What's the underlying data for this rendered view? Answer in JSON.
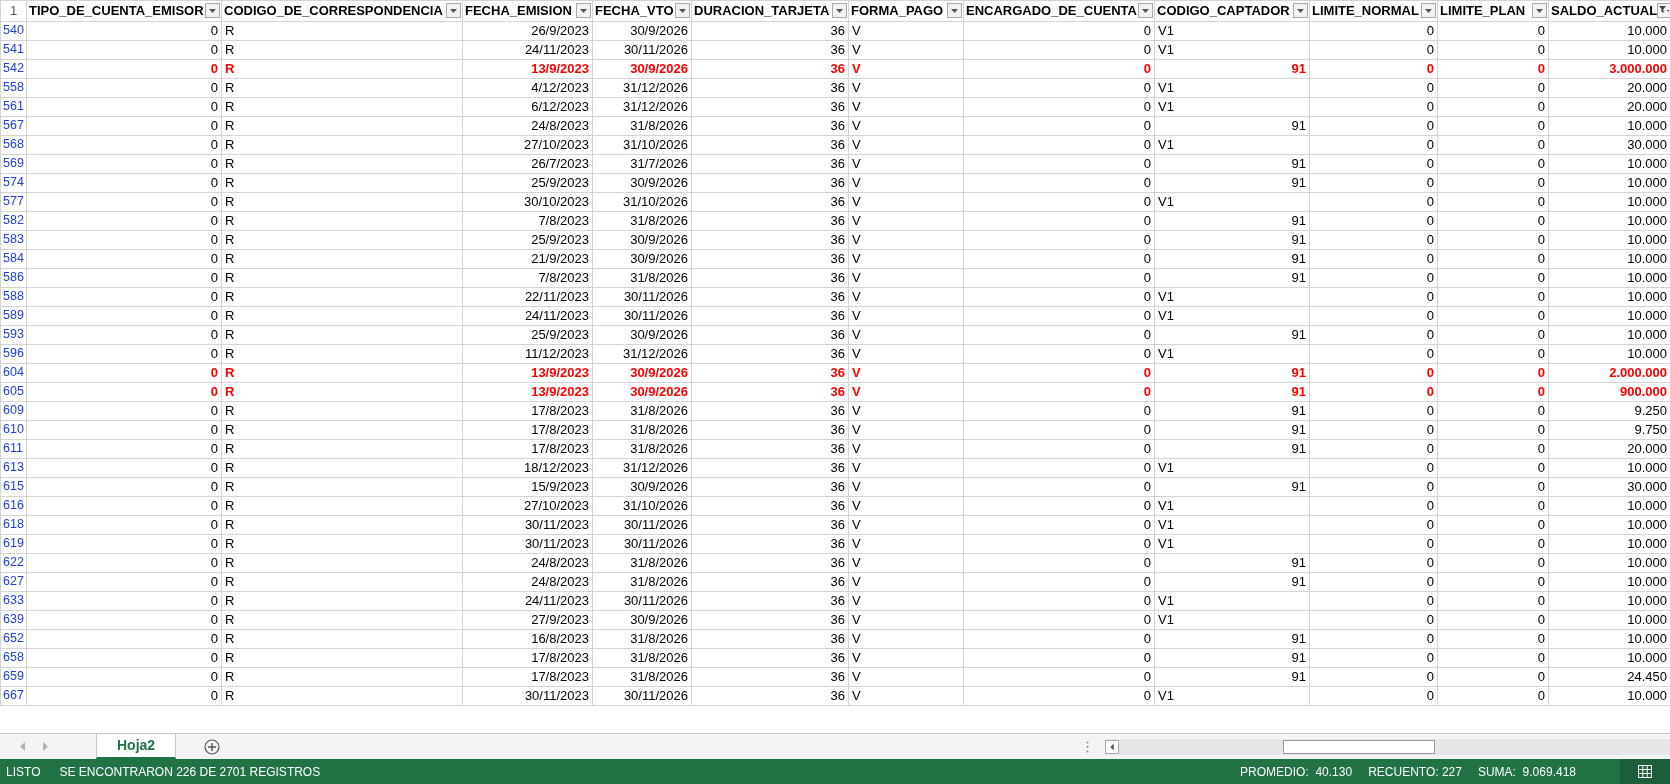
{
  "corner": "1",
  "columns": [
    {
      "label": "TIPO_DE_CUENTA_EMISOR",
      "filtered": false
    },
    {
      "label": "CODIGO_DE_CORRESPONDENCIA",
      "filtered": false
    },
    {
      "label": "FECHA_EMISION",
      "filtered": false
    },
    {
      "label": "FECHA_VTO",
      "filtered": false
    },
    {
      "label": "DURACION_TARJETA",
      "filtered": false
    },
    {
      "label": "FORMA_PAGO",
      "filtered": false
    },
    {
      "label": "ENCARGADO_DE_CUENTA",
      "filtered": false
    },
    {
      "label": "CODIGO_CAPTADOR",
      "filtered": false
    },
    {
      "label": "LIMITE_NORMAL",
      "filtered": false
    },
    {
      "label": "LIMITE_PLAN",
      "filtered": false
    },
    {
      "label": "SALDO_ACTUAL",
      "filtered": true
    }
  ],
  "rows": [
    {
      "num": "540",
      "highlighted": false,
      "captador_numeric": false,
      "cells": [
        "0",
        "R",
        "26/9/2023",
        "30/9/2026",
        "36",
        "V",
        "0",
        "V1",
        "0",
        "0",
        "10.000"
      ]
    },
    {
      "num": "541",
      "highlighted": false,
      "captador_numeric": false,
      "cells": [
        "0",
        "R",
        "24/11/2023",
        "30/11/2026",
        "36",
        "V",
        "0",
        "V1",
        "0",
        "0",
        "10.000"
      ]
    },
    {
      "num": "542",
      "highlighted": true,
      "captador_numeric": true,
      "cells": [
        "0",
        "R",
        "13/9/2023",
        "30/9/2026",
        "36",
        "V",
        "0",
        "91",
        "0",
        "0",
        "3.000.000"
      ]
    },
    {
      "num": "558",
      "highlighted": false,
      "captador_numeric": false,
      "cells": [
        "0",
        "R",
        "4/12/2023",
        "31/12/2026",
        "36",
        "V",
        "0",
        "V1",
        "0",
        "0",
        "20.000"
      ]
    },
    {
      "num": "561",
      "highlighted": false,
      "captador_numeric": false,
      "cells": [
        "0",
        "R",
        "6/12/2023",
        "31/12/2026",
        "36",
        "V",
        "0",
        "V1",
        "0",
        "0",
        "20.000"
      ]
    },
    {
      "num": "567",
      "highlighted": false,
      "captador_numeric": true,
      "cells": [
        "0",
        "R",
        "24/8/2023",
        "31/8/2026",
        "36",
        "V",
        "0",
        "91",
        "0",
        "0",
        "10.000"
      ]
    },
    {
      "num": "568",
      "highlighted": false,
      "captador_numeric": false,
      "cells": [
        "0",
        "R",
        "27/10/2023",
        "31/10/2026",
        "36",
        "V",
        "0",
        "V1",
        "0",
        "0",
        "30.000"
      ]
    },
    {
      "num": "569",
      "highlighted": false,
      "captador_numeric": true,
      "cells": [
        "0",
        "R",
        "26/7/2023",
        "31/7/2026",
        "36",
        "V",
        "0",
        "91",
        "0",
        "0",
        "10.000"
      ]
    },
    {
      "num": "574",
      "highlighted": false,
      "captador_numeric": true,
      "cells": [
        "0",
        "R",
        "25/9/2023",
        "30/9/2026",
        "36",
        "V",
        "0",
        "91",
        "0",
        "0",
        "10.000"
      ]
    },
    {
      "num": "577",
      "highlighted": false,
      "captador_numeric": false,
      "cells": [
        "0",
        "R",
        "30/10/2023",
        "31/10/2026",
        "36",
        "V",
        "0",
        "V1",
        "0",
        "0",
        "10.000"
      ]
    },
    {
      "num": "582",
      "highlighted": false,
      "captador_numeric": true,
      "cells": [
        "0",
        "R",
        "7/8/2023",
        "31/8/2026",
        "36",
        "V",
        "0",
        "91",
        "0",
        "0",
        "10.000"
      ]
    },
    {
      "num": "583",
      "highlighted": false,
      "captador_numeric": true,
      "cells": [
        "0",
        "R",
        "25/9/2023",
        "30/9/2026",
        "36",
        "V",
        "0",
        "91",
        "0",
        "0",
        "10.000"
      ]
    },
    {
      "num": "584",
      "highlighted": false,
      "captador_numeric": true,
      "cells": [
        "0",
        "R",
        "21/9/2023",
        "30/9/2026",
        "36",
        "V",
        "0",
        "91",
        "0",
        "0",
        "10.000"
      ]
    },
    {
      "num": "586",
      "highlighted": false,
      "captador_numeric": true,
      "cells": [
        "0",
        "R",
        "7/8/2023",
        "31/8/2026",
        "36",
        "V",
        "0",
        "91",
        "0",
        "0",
        "10.000"
      ]
    },
    {
      "num": "588",
      "highlighted": false,
      "captador_numeric": false,
      "cells": [
        "0",
        "R",
        "22/11/2023",
        "30/11/2026",
        "36",
        "V",
        "0",
        "V1",
        "0",
        "0",
        "10.000"
      ]
    },
    {
      "num": "589",
      "highlighted": false,
      "captador_numeric": false,
      "cells": [
        "0",
        "R",
        "24/11/2023",
        "30/11/2026",
        "36",
        "V",
        "0",
        "V1",
        "0",
        "0",
        "10.000"
      ]
    },
    {
      "num": "593",
      "highlighted": false,
      "captador_numeric": true,
      "cells": [
        "0",
        "R",
        "25/9/2023",
        "30/9/2026",
        "36",
        "V",
        "0",
        "91",
        "0",
        "0",
        "10.000"
      ]
    },
    {
      "num": "596",
      "highlighted": false,
      "captador_numeric": false,
      "cells": [
        "0",
        "R",
        "11/12/2023",
        "31/12/2026",
        "36",
        "V",
        "0",
        "V1",
        "0",
        "0",
        "10.000"
      ]
    },
    {
      "num": "604",
      "highlighted": true,
      "captador_numeric": true,
      "cells": [
        "0",
        "R",
        "13/9/2023",
        "30/9/2026",
        "36",
        "V",
        "0",
        "91",
        "0",
        "0",
        "2.000.000"
      ]
    },
    {
      "num": "605",
      "highlighted": true,
      "captador_numeric": true,
      "cells": [
        "0",
        "R",
        "13/9/2023",
        "30/9/2026",
        "36",
        "V",
        "0",
        "91",
        "0",
        "0",
        "900.000"
      ]
    },
    {
      "num": "609",
      "highlighted": false,
      "captador_numeric": true,
      "cells": [
        "0",
        "R",
        "17/8/2023",
        "31/8/2026",
        "36",
        "V",
        "0",
        "91",
        "0",
        "0",
        "9.250"
      ]
    },
    {
      "num": "610",
      "highlighted": false,
      "captador_numeric": true,
      "cells": [
        "0",
        "R",
        "17/8/2023",
        "31/8/2026",
        "36",
        "V",
        "0",
        "91",
        "0",
        "0",
        "9.750"
      ]
    },
    {
      "num": "611",
      "highlighted": false,
      "captador_numeric": true,
      "cells": [
        "0",
        "R",
        "17/8/2023",
        "31/8/2026",
        "36",
        "V",
        "0",
        "91",
        "0",
        "0",
        "20.000"
      ]
    },
    {
      "num": "613",
      "highlighted": false,
      "captador_numeric": false,
      "cells": [
        "0",
        "R",
        "18/12/2023",
        "31/12/2026",
        "36",
        "V",
        "0",
        "V1",
        "0",
        "0",
        "10.000"
      ]
    },
    {
      "num": "615",
      "highlighted": false,
      "captador_numeric": true,
      "cells": [
        "0",
        "R",
        "15/9/2023",
        "30/9/2026",
        "36",
        "V",
        "0",
        "91",
        "0",
        "0",
        "30.000"
      ]
    },
    {
      "num": "616",
      "highlighted": false,
      "captador_numeric": false,
      "cells": [
        "0",
        "R",
        "27/10/2023",
        "31/10/2026",
        "36",
        "V",
        "0",
        "V1",
        "0",
        "0",
        "10.000"
      ]
    },
    {
      "num": "618",
      "highlighted": false,
      "captador_numeric": false,
      "cells": [
        "0",
        "R",
        "30/11/2023",
        "30/11/2026",
        "36",
        "V",
        "0",
        "V1",
        "0",
        "0",
        "10.000"
      ]
    },
    {
      "num": "619",
      "highlighted": false,
      "captador_numeric": false,
      "cells": [
        "0",
        "R",
        "30/11/2023",
        "30/11/2026",
        "36",
        "V",
        "0",
        "V1",
        "0",
        "0",
        "10.000"
      ]
    },
    {
      "num": "622",
      "highlighted": false,
      "captador_numeric": true,
      "cells": [
        "0",
        "R",
        "24/8/2023",
        "31/8/2026",
        "36",
        "V",
        "0",
        "91",
        "0",
        "0",
        "10.000"
      ]
    },
    {
      "num": "627",
      "highlighted": false,
      "captador_numeric": true,
      "cells": [
        "0",
        "R",
        "24/8/2023",
        "31/8/2026",
        "36",
        "V",
        "0",
        "91",
        "0",
        "0",
        "10.000"
      ]
    },
    {
      "num": "633",
      "highlighted": false,
      "captador_numeric": false,
      "cells": [
        "0",
        "R",
        "24/11/2023",
        "30/11/2026",
        "36",
        "V",
        "0",
        "V1",
        "0",
        "0",
        "10.000"
      ]
    },
    {
      "num": "639",
      "highlighted": false,
      "captador_numeric": false,
      "cells": [
        "0",
        "R",
        "27/9/2023",
        "30/9/2026",
        "36",
        "V",
        "0",
        "V1",
        "0",
        "0",
        "10.000"
      ]
    },
    {
      "num": "652",
      "highlighted": false,
      "captador_numeric": true,
      "cells": [
        "0",
        "R",
        "16/8/2023",
        "31/8/2026",
        "36",
        "V",
        "0",
        "91",
        "0",
        "0",
        "10.000"
      ]
    },
    {
      "num": "658",
      "highlighted": false,
      "captador_numeric": true,
      "cells": [
        "0",
        "R",
        "17/8/2023",
        "31/8/2026",
        "36",
        "V",
        "0",
        "91",
        "0",
        "0",
        "10.000"
      ]
    },
    {
      "num": "659",
      "highlighted": false,
      "captador_numeric": true,
      "cells": [
        "0",
        "R",
        "17/8/2023",
        "31/8/2026",
        "36",
        "V",
        "0",
        "91",
        "0",
        "0",
        "24.450"
      ]
    },
    {
      "num": "667",
      "highlighted": false,
      "captador_numeric": false,
      "cells": [
        "0",
        "R",
        "30/11/2023",
        "30/11/2026",
        "36",
        "V",
        "0",
        "V1",
        "0",
        "0",
        "10.000"
      ]
    }
  ],
  "sheet_tabs": [
    {
      "label": "Hoja2",
      "selected": true
    }
  ],
  "status_bar": {
    "mode": "LISTO",
    "message": "SE ENCONTRARON 226 DE 2701 REGISTROS",
    "stats": [
      "PROMEDIO:  40.130",
      "RECUENTO: 227",
      "SUMA:  9.069.418"
    ]
  }
}
